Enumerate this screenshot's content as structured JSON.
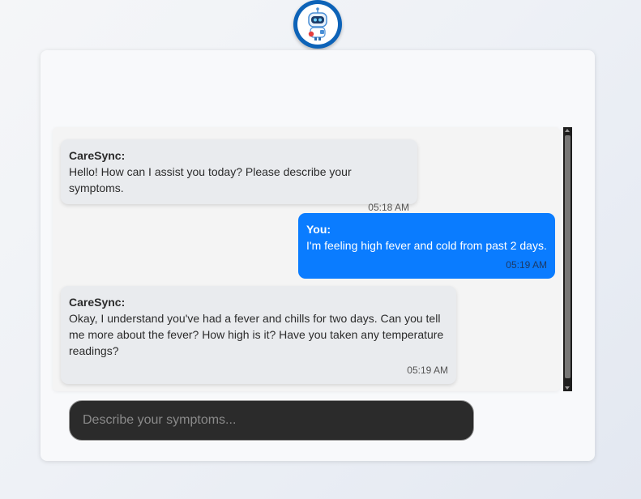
{
  "app": {
    "logo_icon": "robot-doctor-icon",
    "brand_color": "#0d63b8"
  },
  "chat": {
    "messages": [
      {
        "sender": "CareSync:",
        "text": "Hello! How can I assist you today? Please describe your symptoms.",
        "time": "05:18 AM",
        "role": "bot"
      },
      {
        "sender": "You:",
        "text": "I'm feeling high fever and cold from past 2 days.",
        "time": "05:19 AM",
        "role": "user"
      },
      {
        "sender": "CareSync:",
        "text": "Okay, I understand you've had a fever and chills for two days. Can you tell me more about the fever? How high is it? Have you taken any temperature readings?",
        "time": "05:19 AM",
        "role": "bot"
      }
    ]
  },
  "input": {
    "placeholder": "Describe your symptoms...",
    "value": ""
  },
  "colors": {
    "user_bubble": "#0a7cff",
    "bot_bubble": "#e9ebee",
    "input_bg": "#2b2b2b"
  }
}
